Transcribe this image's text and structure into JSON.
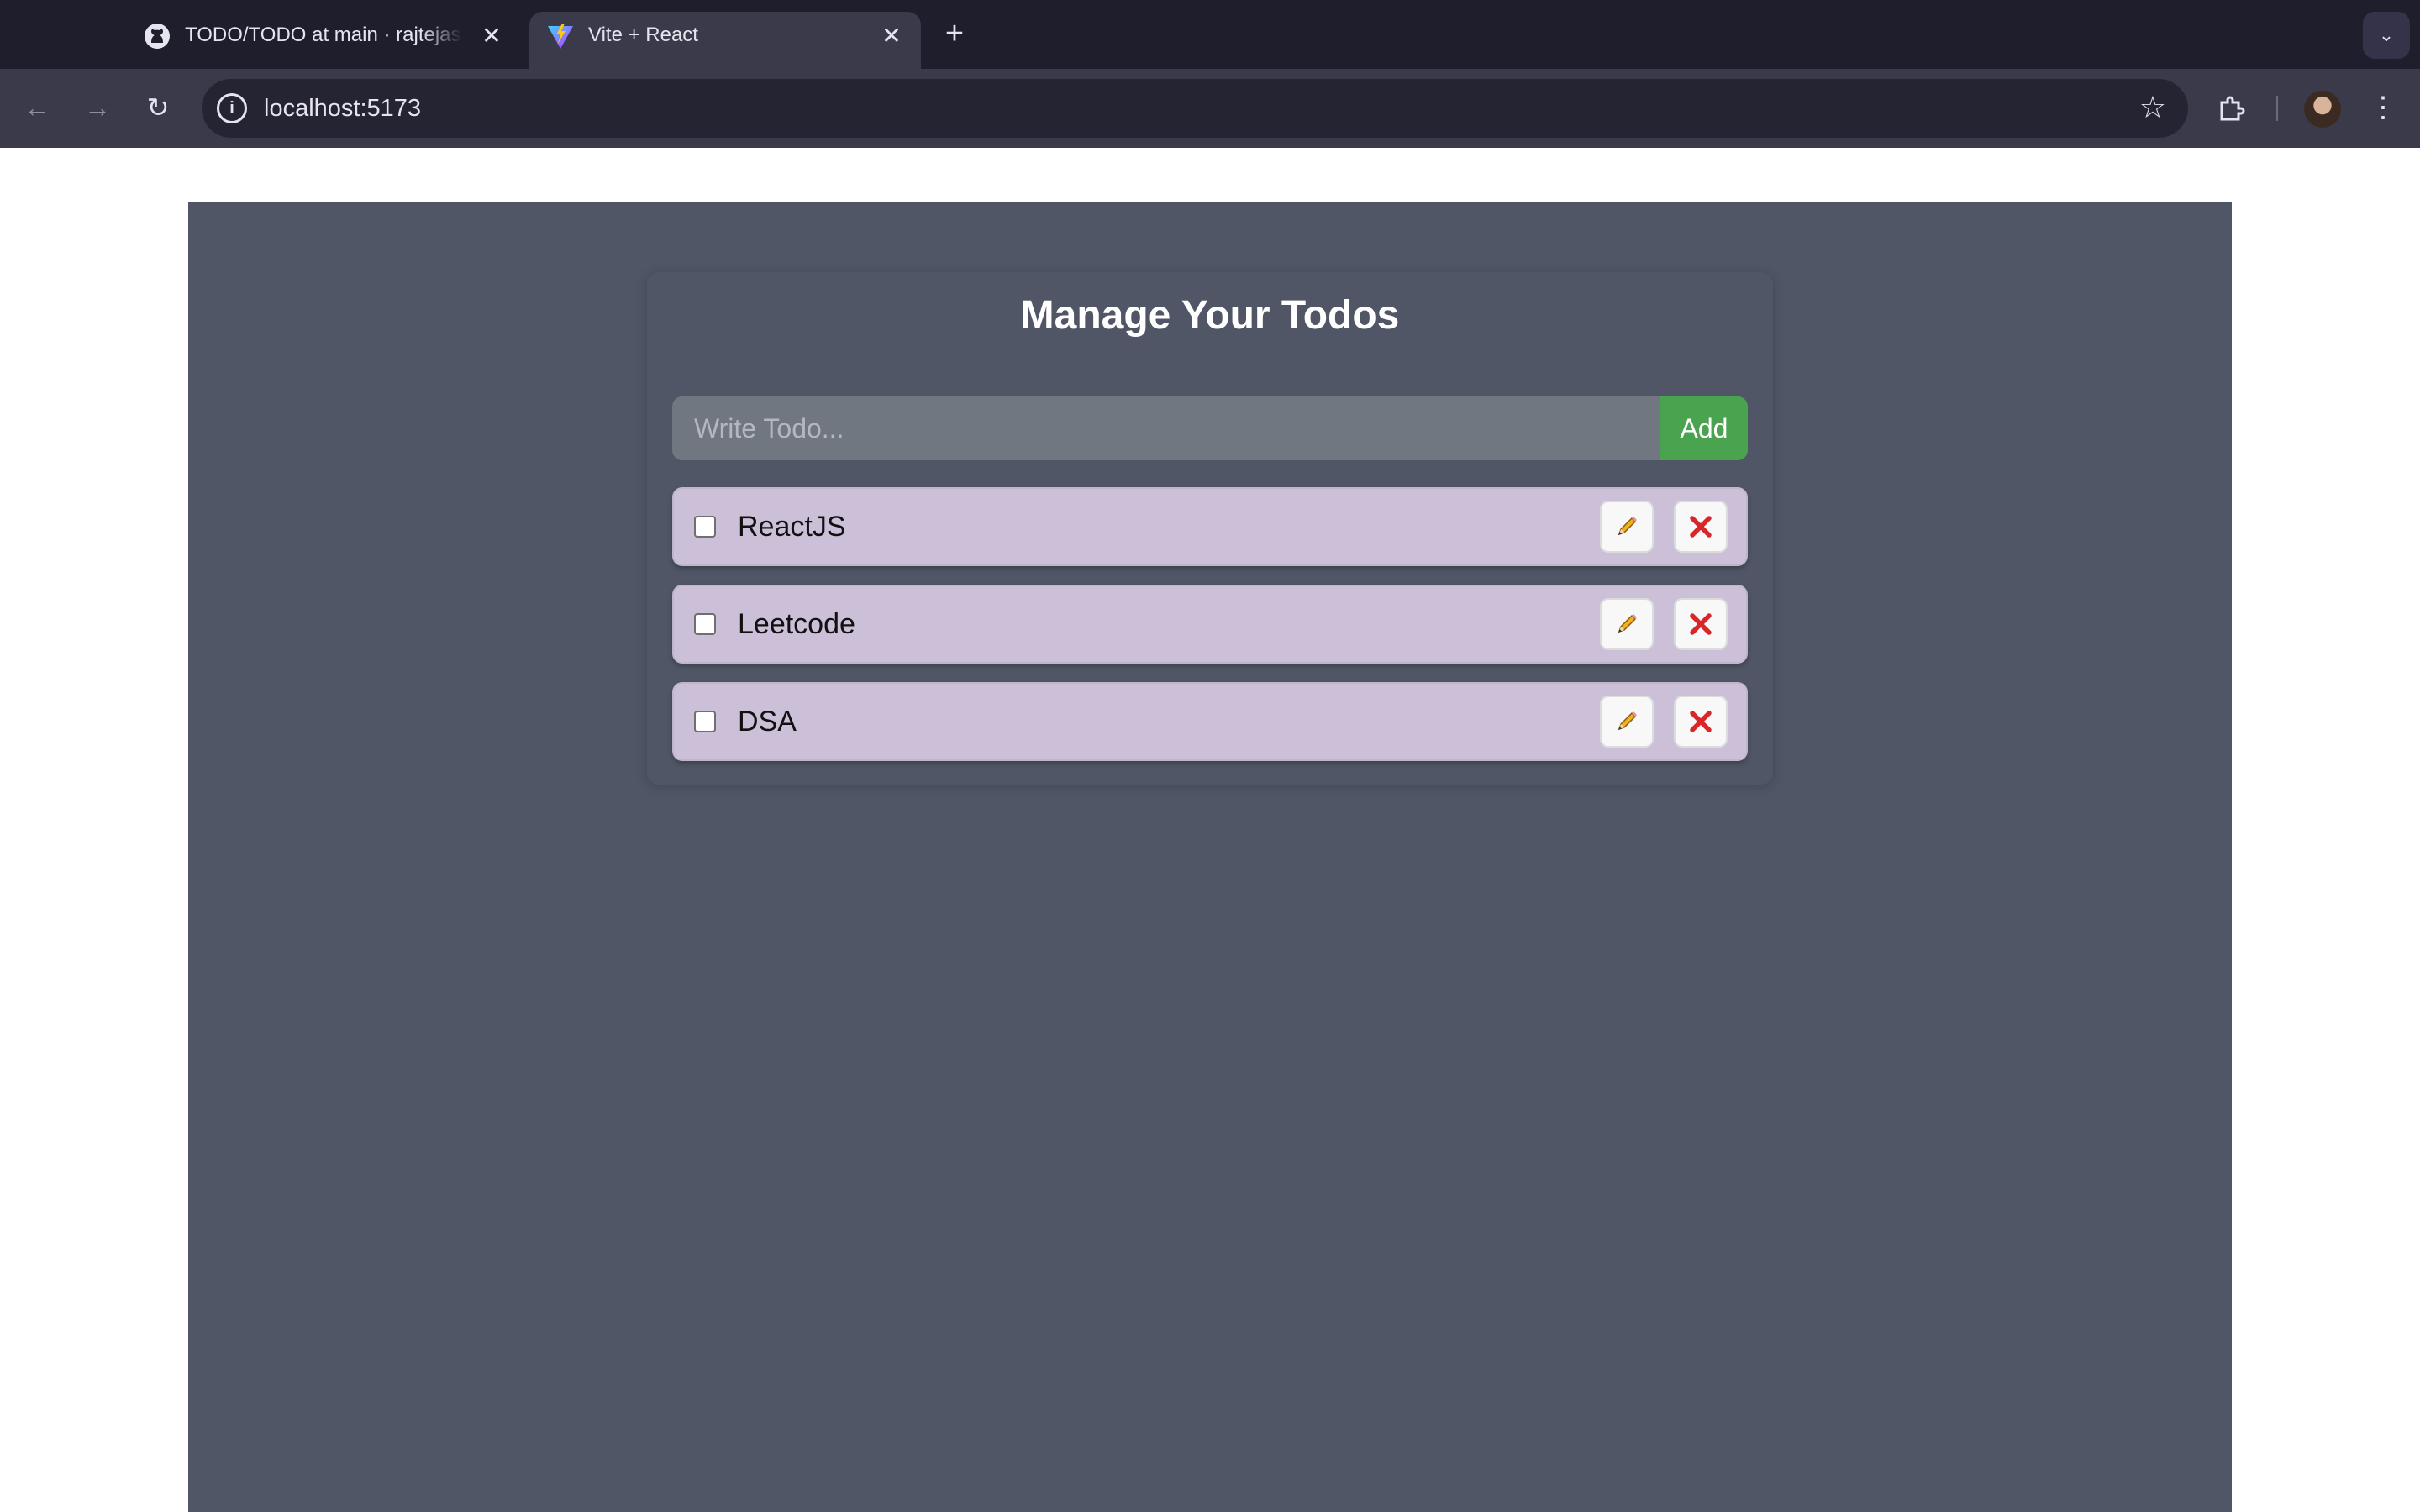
{
  "browser": {
    "tabs": [
      {
        "title": "TODO/TODO at main · rajtejas",
        "active": false
      },
      {
        "title": "Vite + React",
        "active": true
      }
    ],
    "new_tab_label": "+",
    "address": "localhost:5173"
  },
  "app": {
    "heading": "Manage Your Todos",
    "input_placeholder": "Write Todo...",
    "add_label": "Add",
    "todos": [
      {
        "text": "ReactJS",
        "completed": false
      },
      {
        "text": "Leetcode",
        "completed": false
      },
      {
        "text": "DSA",
        "completed": false
      }
    ]
  },
  "colors": {
    "page_background": "#505665",
    "todo_background": "#ccc0d9",
    "add_button": "#4aa34f",
    "delete_icon": "#d9262b"
  },
  "icons": {
    "edit": "pencil-icon",
    "delete": "x-icon"
  }
}
